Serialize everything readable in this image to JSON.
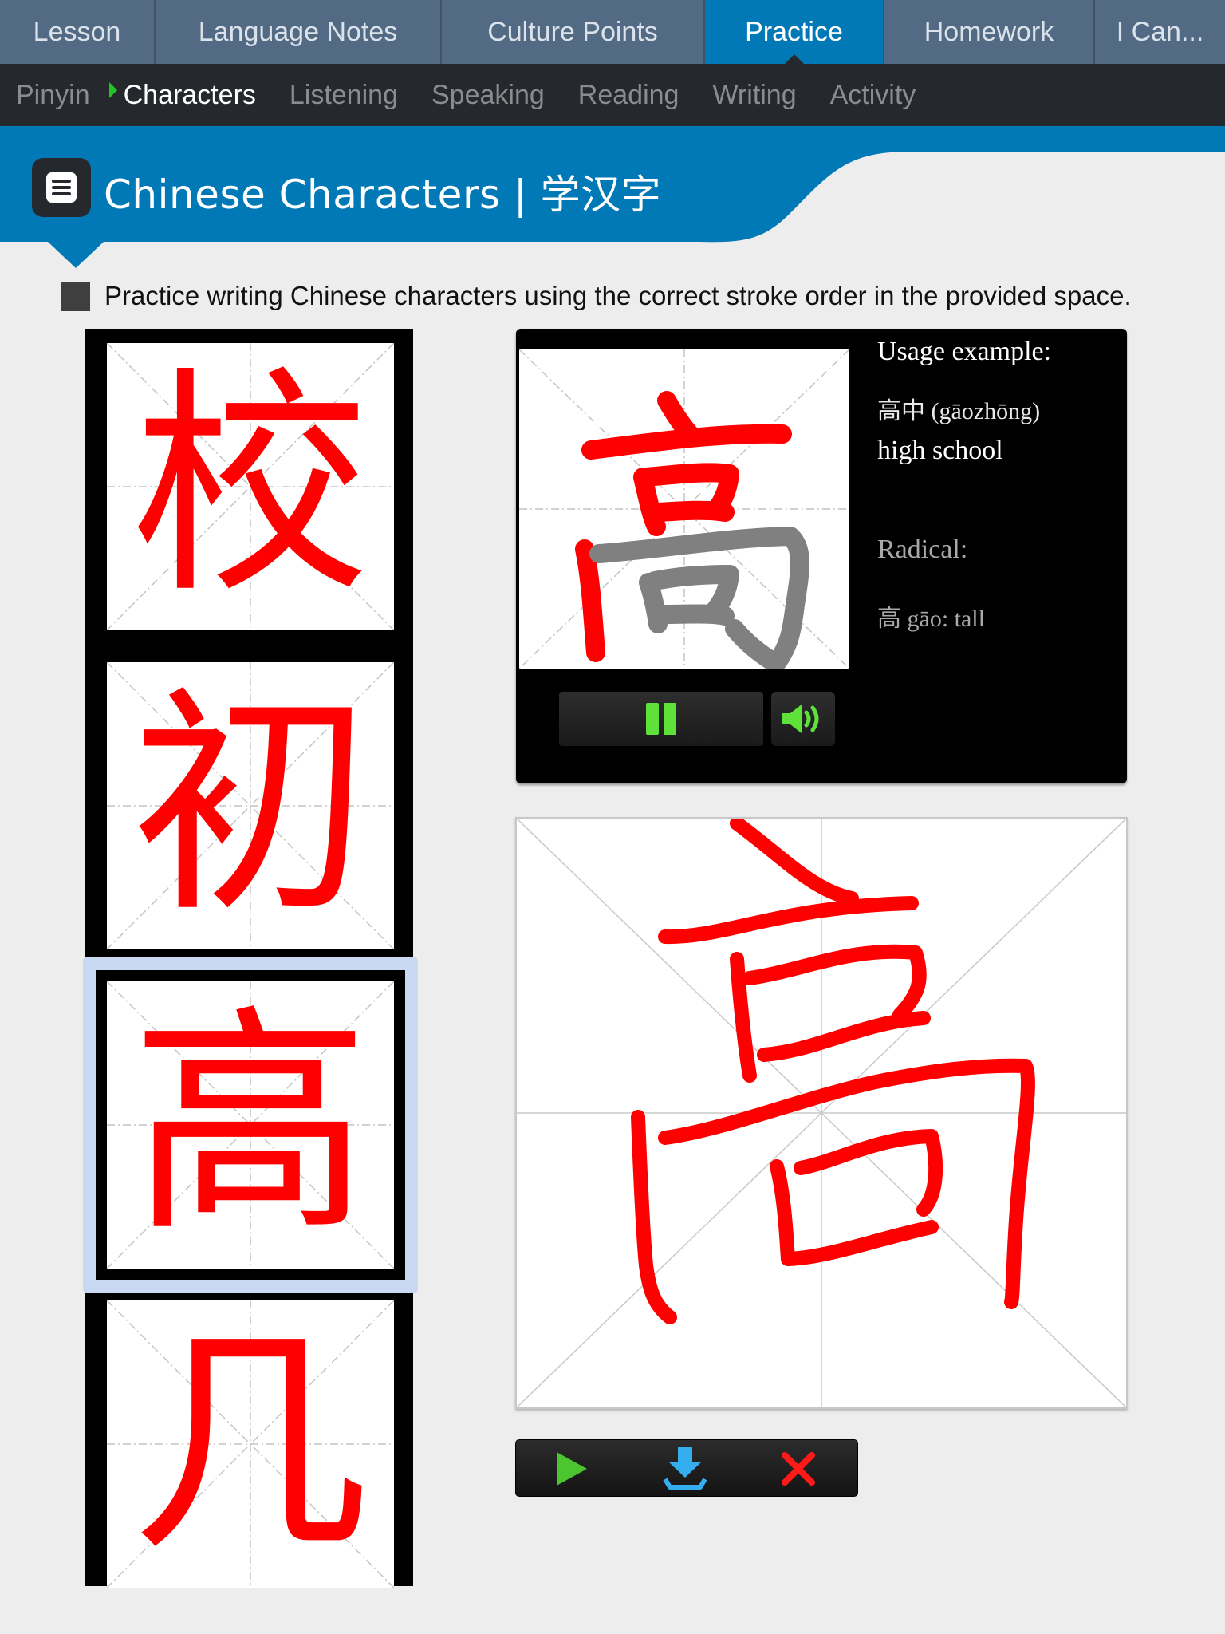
{
  "tabs": [
    {
      "label": "Lesson",
      "active": false
    },
    {
      "label": "Language Notes",
      "active": false
    },
    {
      "label": "Culture Points",
      "active": false
    },
    {
      "label": "Practice",
      "active": true
    },
    {
      "label": "Homework",
      "active": false
    },
    {
      "label": "I Can...",
      "active": false
    }
  ],
  "subnav": [
    {
      "label": "Pinyin",
      "active": false
    },
    {
      "label": "Characters",
      "active": true
    },
    {
      "label": "Listening",
      "active": false
    },
    {
      "label": "Speaking",
      "active": false
    },
    {
      "label": "Reading",
      "active": false
    },
    {
      "label": "Writing",
      "active": false
    },
    {
      "label": "Activity",
      "active": false
    }
  ],
  "banner": {
    "icon": "document-list-icon",
    "title": "Chinese Characters | 学汉字"
  },
  "instruction": "Practice writing Chinese characters using the correct stroke order in the provided space.",
  "characters": [
    {
      "char": "校",
      "selected": false
    },
    {
      "char": "初",
      "selected": false
    },
    {
      "char": "高",
      "selected": true
    },
    {
      "char": "几",
      "selected": false
    }
  ],
  "animation": {
    "char": "高",
    "strokes_completed": 6,
    "strokes_total": 10,
    "pause_icon": "pause-icon",
    "sound_icon": "speaker-icon"
  },
  "info": {
    "usage_label": "Usage example:",
    "usage_word": "高中 (gāozhōng)",
    "usage_meaning": "high school",
    "radical_label": "Radical:",
    "radical_value": "高 gāo: tall"
  },
  "toolbar": {
    "play_icon": "play-icon",
    "save_icon": "download-icon",
    "clear_icon": "clear-x-icon"
  },
  "colors": {
    "tab_bg": "#526a83",
    "tab_active": "#0079b6",
    "subnav_bg": "#25282c",
    "accent_green": "#5ee23a",
    "stroke_red": "#ff0000",
    "stroke_pending": "#808080",
    "selection": "#c9d9f1"
  }
}
